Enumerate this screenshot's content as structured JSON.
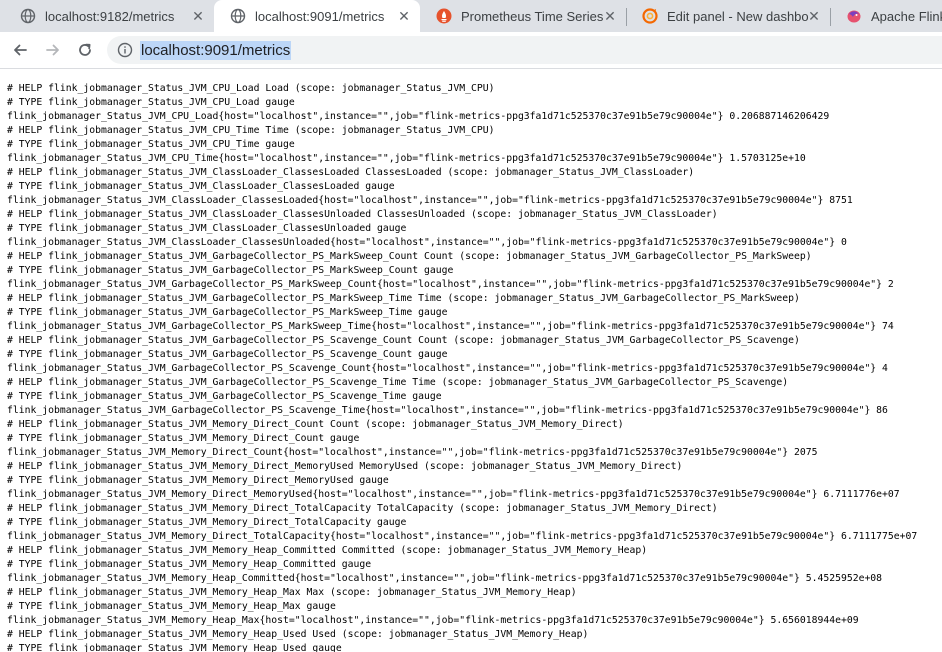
{
  "tabs": [
    {
      "title": "localhost:9182/metrics",
      "icon": "globe-icon",
      "active": false
    },
    {
      "title": "localhost:9091/metrics",
      "icon": "globe-icon",
      "active": true
    },
    {
      "title": "Prometheus Time Series",
      "icon": "prometheus-icon",
      "active": false
    },
    {
      "title": "Edit panel - New dashbo",
      "icon": "grafana-icon",
      "active": false
    },
    {
      "title": "Apache Flink",
      "icon": "flink-icon",
      "active": false
    }
  ],
  "toolbar": {
    "url": "localhost:9091/metrics"
  },
  "colors": {
    "tabstrip": "#dee1e6",
    "url_highlight": "#bcd6f7",
    "prometheus": "#e6522c",
    "grafana": "#f46800"
  },
  "metrics_lines": [
    "# HELP flink_jobmanager_Status_JVM_CPU_Load Load (scope: jobmanager_Status_JVM_CPU)",
    "# TYPE flink_jobmanager_Status_JVM_CPU_Load gauge",
    "flink_jobmanager_Status_JVM_CPU_Load{host=\"localhost\",instance=\"\",job=\"flink-metrics-ppg3fa1d71c525370c37e91b5e79c90004e\"} 0.206887146206429",
    "# HELP flink_jobmanager_Status_JVM_CPU_Time Time (scope: jobmanager_Status_JVM_CPU)",
    "# TYPE flink_jobmanager_Status_JVM_CPU_Time gauge",
    "flink_jobmanager_Status_JVM_CPU_Time{host=\"localhost\",instance=\"\",job=\"flink-metrics-ppg3fa1d71c525370c37e91b5e79c90004e\"} 1.5703125e+10",
    "# HELP flink_jobmanager_Status_JVM_ClassLoader_ClassesLoaded ClassesLoaded (scope: jobmanager_Status_JVM_ClassLoader)",
    "# TYPE flink_jobmanager_Status_JVM_ClassLoader_ClassesLoaded gauge",
    "flink_jobmanager_Status_JVM_ClassLoader_ClassesLoaded{host=\"localhost\",instance=\"\",job=\"flink-metrics-ppg3fa1d71c525370c37e91b5e79c90004e\"} 8751",
    "# HELP flink_jobmanager_Status_JVM_ClassLoader_ClassesUnloaded ClassesUnloaded (scope: jobmanager_Status_JVM_ClassLoader)",
    "# TYPE flink_jobmanager_Status_JVM_ClassLoader_ClassesUnloaded gauge",
    "flink_jobmanager_Status_JVM_ClassLoader_ClassesUnloaded{host=\"localhost\",instance=\"\",job=\"flink-metrics-ppg3fa1d71c525370c37e91b5e79c90004e\"} 0",
    "# HELP flink_jobmanager_Status_JVM_GarbageCollector_PS_MarkSweep_Count Count (scope: jobmanager_Status_JVM_GarbageCollector_PS_MarkSweep)",
    "# TYPE flink_jobmanager_Status_JVM_GarbageCollector_PS_MarkSweep_Count gauge",
    "flink_jobmanager_Status_JVM_GarbageCollector_PS_MarkSweep_Count{host=\"localhost\",instance=\"\",job=\"flink-metrics-ppg3fa1d71c525370c37e91b5e79c90004e\"} 2",
    "# HELP flink_jobmanager_Status_JVM_GarbageCollector_PS_MarkSweep_Time Time (scope: jobmanager_Status_JVM_GarbageCollector_PS_MarkSweep)",
    "# TYPE flink_jobmanager_Status_JVM_GarbageCollector_PS_MarkSweep_Time gauge",
    "flink_jobmanager_Status_JVM_GarbageCollector_PS_MarkSweep_Time{host=\"localhost\",instance=\"\",job=\"flink-metrics-ppg3fa1d71c525370c37e91b5e79c90004e\"} 74",
    "# HELP flink_jobmanager_Status_JVM_GarbageCollector_PS_Scavenge_Count Count (scope: jobmanager_Status_JVM_GarbageCollector_PS_Scavenge)",
    "# TYPE flink_jobmanager_Status_JVM_GarbageCollector_PS_Scavenge_Count gauge",
    "flink_jobmanager_Status_JVM_GarbageCollector_PS_Scavenge_Count{host=\"localhost\",instance=\"\",job=\"flink-metrics-ppg3fa1d71c525370c37e91b5e79c90004e\"} 4",
    "# HELP flink_jobmanager_Status_JVM_GarbageCollector_PS_Scavenge_Time Time (scope: jobmanager_Status_JVM_GarbageCollector_PS_Scavenge)",
    "# TYPE flink_jobmanager_Status_JVM_GarbageCollector_PS_Scavenge_Time gauge",
    "flink_jobmanager_Status_JVM_GarbageCollector_PS_Scavenge_Time{host=\"localhost\",instance=\"\",job=\"flink-metrics-ppg3fa1d71c525370c37e91b5e79c90004e\"} 86",
    "# HELP flink_jobmanager_Status_JVM_Memory_Direct_Count Count (scope: jobmanager_Status_JVM_Memory_Direct)",
    "# TYPE flink_jobmanager_Status_JVM_Memory_Direct_Count gauge",
    "flink_jobmanager_Status_JVM_Memory_Direct_Count{host=\"localhost\",instance=\"\",job=\"flink-metrics-ppg3fa1d71c525370c37e91b5e79c90004e\"} 2075",
    "# HELP flink_jobmanager_Status_JVM_Memory_Direct_MemoryUsed MemoryUsed (scope: jobmanager_Status_JVM_Memory_Direct)",
    "# TYPE flink_jobmanager_Status_JVM_Memory_Direct_MemoryUsed gauge",
    "flink_jobmanager_Status_JVM_Memory_Direct_MemoryUsed{host=\"localhost\",instance=\"\",job=\"flink-metrics-ppg3fa1d71c525370c37e91b5e79c90004e\"} 6.7111776e+07",
    "# HELP flink_jobmanager_Status_JVM_Memory_Direct_TotalCapacity TotalCapacity (scope: jobmanager_Status_JVM_Memory_Direct)",
    "# TYPE flink_jobmanager_Status_JVM_Memory_Direct_TotalCapacity gauge",
    "flink_jobmanager_Status_JVM_Memory_Direct_TotalCapacity{host=\"localhost\",instance=\"\",job=\"flink-metrics-ppg3fa1d71c525370c37e91b5e79c90004e\"} 6.7111775e+07",
    "# HELP flink_jobmanager_Status_JVM_Memory_Heap_Committed Committed (scope: jobmanager_Status_JVM_Memory_Heap)",
    "# TYPE flink_jobmanager_Status_JVM_Memory_Heap_Committed gauge",
    "flink_jobmanager_Status_JVM_Memory_Heap_Committed{host=\"localhost\",instance=\"\",job=\"flink-metrics-ppg3fa1d71c525370c37e91b5e79c90004e\"} 5.4525952e+08",
    "# HELP flink_jobmanager_Status_JVM_Memory_Heap_Max Max (scope: jobmanager_Status_JVM_Memory_Heap)",
    "# TYPE flink_jobmanager_Status_JVM_Memory_Heap_Max gauge",
    "flink_jobmanager_Status_JVM_Memory_Heap_Max{host=\"localhost\",instance=\"\",job=\"flink-metrics-ppg3fa1d71c525370c37e91b5e79c90004e\"} 5.656018944e+09",
    "# HELP flink_jobmanager_Status_JVM_Memory_Heap_Used Used (scope: jobmanager_Status_JVM_Memory_Heap)",
    "# TYPE flink_jobmanager_Status_JVM_Memory_Heap_Used gauge"
  ]
}
